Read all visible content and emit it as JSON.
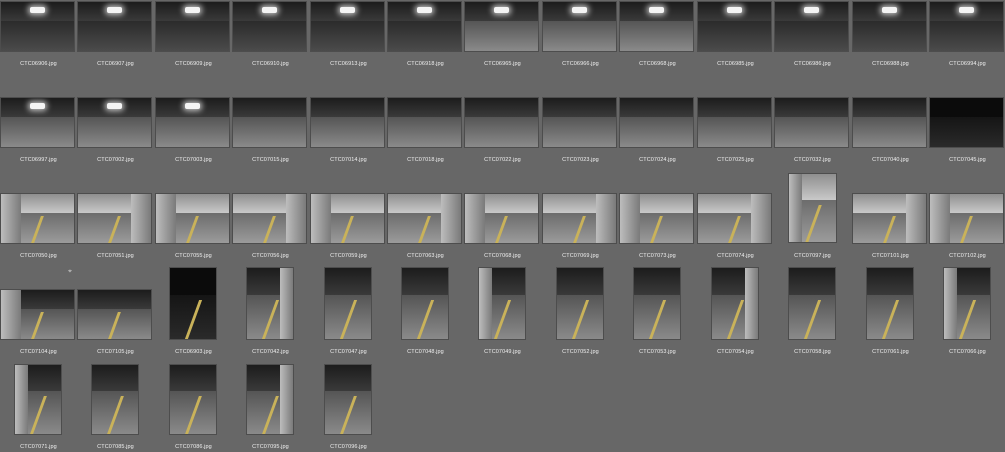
{
  "files": [
    "CTC06906.jpg",
    "CTC06907.jpg",
    "CTC06909.jpg",
    "CTC06910.jpg",
    "CTC06913.jpg",
    "CTC06918.jpg",
    "CTC06965.jpg",
    "CTC06966.jpg",
    "CTC06968.jpg",
    "CTC06985.jpg",
    "CTC06986.jpg",
    "CTC06988.jpg",
    "CTC06994.jpg",
    "CTC06997.jpg",
    "CTC07002.jpg",
    "CTC07003.jpg",
    "CTC07015.jpg",
    "CTC07014.jpg",
    "CTC07018.jpg",
    "CTC07022.jpg",
    "CTC07023.jpg",
    "CTC07024.jpg",
    "CTC07025.jpg",
    "CTC07032.jpg",
    "CTC07040.jpg",
    "CTC07045.jpg",
    "CTC07050.jpg",
    "CTC07051.jpg",
    "CTC07055.jpg",
    "CTC07056.jpg",
    "CTC07059.jpg",
    "CTC07063.jpg",
    "CTC07068.jpg",
    "CTC07069.jpg",
    "CTC07073.jpg",
    "CTC07074.jpg",
    "CTC07097.jpg",
    "CTC07101.jpg",
    "CTC07102.jpg",
    "CTC07104.jpg",
    "CTC07105.jpg",
    "CTC06903.jpg",
    "CTC07042.jpg",
    "CTC07047.jpg",
    "CTC07048.jpg",
    "CTC07049.jpg",
    "CTC07052.jpg",
    "CTC07053.jpg",
    "CTC07054.jpg",
    "CTC07058.jpg",
    "CTC07061.jpg",
    "CTC07066.jpg",
    "CTC07071.jpg",
    "CTC07085.jpg",
    "CTC07086.jpg",
    "CTC07095.jpg",
    "CTC07096.jpg"
  ],
  "colors": {
    "background": "#676767",
    "label_text": "#f0f0f0"
  }
}
